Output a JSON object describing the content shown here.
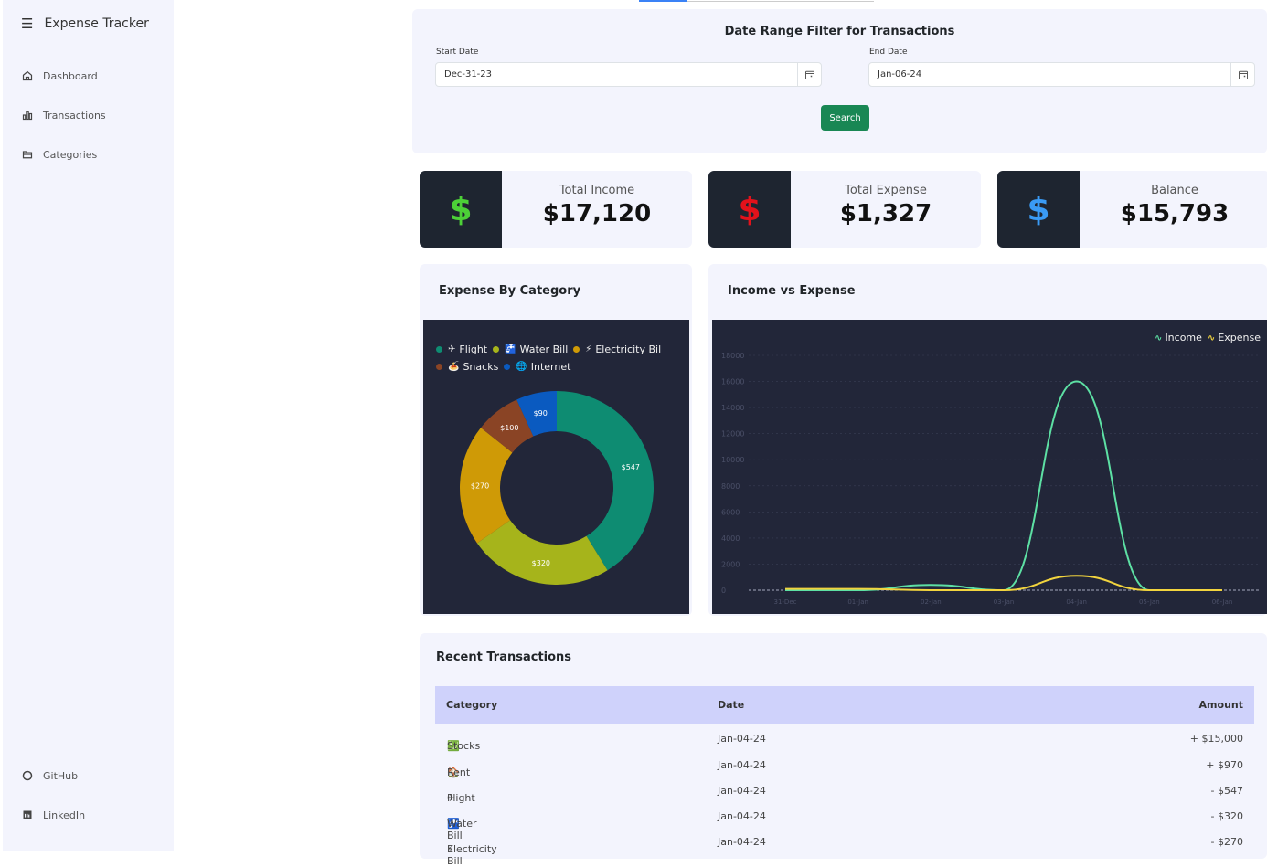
{
  "sidebar": {
    "brand": "Expense Tracker",
    "items": [
      {
        "label": "Dashboard",
        "icon": "home-icon"
      },
      {
        "label": "Transactions",
        "icon": "bar-chart-icon"
      },
      {
        "label": "Categories",
        "icon": "folder-icon"
      }
    ],
    "footer": [
      {
        "label": "GitHub",
        "icon": "github-icon"
      },
      {
        "label": "LinkedIn",
        "icon": "linkedin-icon"
      }
    ]
  },
  "filter": {
    "title": "Date Range Filter for Transactions",
    "start_label": "Start Date",
    "start_value": "Dec-31-23",
    "end_label": "End Date",
    "end_value": "Jan-06-24",
    "search_label": "Search"
  },
  "stats": [
    {
      "label": "Total Income",
      "value": "$17,120",
      "icon_color": "#4cd137"
    },
    {
      "label": "Total Expense",
      "value": "$1,327",
      "icon_color": "#e3121b"
    },
    {
      "label": "Balance",
      "value": "$15,793",
      "icon_color": "#3a9bf5"
    }
  ],
  "expense_chart": {
    "title": "Expense By Category"
  },
  "income_chart": {
    "title": "Income vs Expense"
  },
  "chart_data": [
    {
      "type": "pie",
      "title": "Expense By Category",
      "categories": [
        "Flight",
        "Water Bill",
        "Electricity Bil",
        "Snacks",
        "Internet"
      ],
      "legend_icons": [
        "✈",
        "🚰",
        "⚡",
        "🍝",
        "🌐"
      ],
      "values": [
        547,
        320,
        270,
        100,
        90
      ],
      "labels": [
        "$547",
        "$320",
        "$270",
        "$100",
        "$90"
      ],
      "colors": [
        "#0e8c72",
        "#a6b41b",
        "#cf9a06",
        "#8a4425",
        "#0a5ac0"
      ],
      "donut": true,
      "legend": "top"
    },
    {
      "type": "line",
      "title": "Income vs Expense",
      "x": [
        "31-Dec",
        "01-Jan",
        "02-Jan",
        "03-Jan",
        "04-Jan",
        "05-Jan",
        "06-Jan"
      ],
      "series": [
        {
          "name": "Income",
          "values": [
            0,
            0,
            400,
            0,
            16000,
            0,
            0
          ],
          "color": "#5de0a4"
        },
        {
          "name": "Expense",
          "values": [
            100,
            100,
            0,
            0,
            1100,
            0,
            0
          ],
          "color": "#f2d43e"
        }
      ],
      "yticks": [
        0,
        2000,
        4000,
        6000,
        8000,
        10000,
        12000,
        14000,
        16000,
        18000
      ],
      "ylim": [
        0,
        18000
      ],
      "grid": true,
      "legend": "top-right"
    }
  ],
  "transactions": {
    "title": "Recent Transactions",
    "headers": [
      "Category",
      "Date",
      "Amount"
    ],
    "rows": [
      {
        "emoji": "💹",
        "category": "Stocks",
        "date": "Jan-04-24",
        "amount": "+ $15,000"
      },
      {
        "emoji": "🏠",
        "category": "Rent",
        "date": "Jan-04-24",
        "amount": "+ $970"
      },
      {
        "emoji": "✈",
        "category": "Flight",
        "date": "Jan-04-24",
        "amount": "- $547"
      },
      {
        "emoji": "🚰",
        "category": "Water Bill",
        "date": "Jan-04-24",
        "amount": "- $320"
      },
      {
        "emoji": "⚡",
        "category": "Electricity Bill",
        "date": "Jan-04-24",
        "amount": "- $270"
      }
    ]
  }
}
